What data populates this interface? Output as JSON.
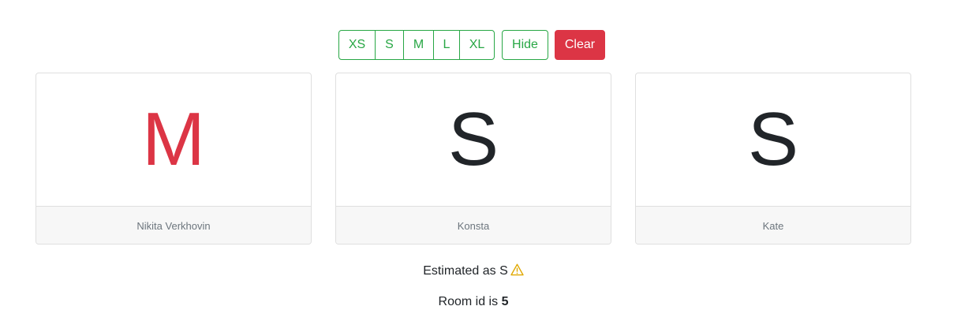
{
  "toolbar": {
    "sizes": [
      "XS",
      "S",
      "M",
      "L",
      "XL"
    ],
    "hide_label": "Hide",
    "clear_label": "Clear"
  },
  "colors": {
    "accent_green": "#28a745",
    "danger_red": "#dc3545",
    "warning_yellow": "#ffc107",
    "text_dark": "#212529",
    "text_muted": "#6c757d"
  },
  "cards": [
    {
      "value": "M",
      "name": "Nikita Verkhovin",
      "value_color": "#dc3545"
    },
    {
      "value": "S",
      "name": "Konsta",
      "value_color": "#212529"
    },
    {
      "value": "S",
      "name": "Kate",
      "value_color": "#212529"
    }
  ],
  "estimate": {
    "text": "Estimated as S",
    "icon": "warning-icon"
  },
  "room": {
    "prefix": "Room id is",
    "id": "5"
  }
}
